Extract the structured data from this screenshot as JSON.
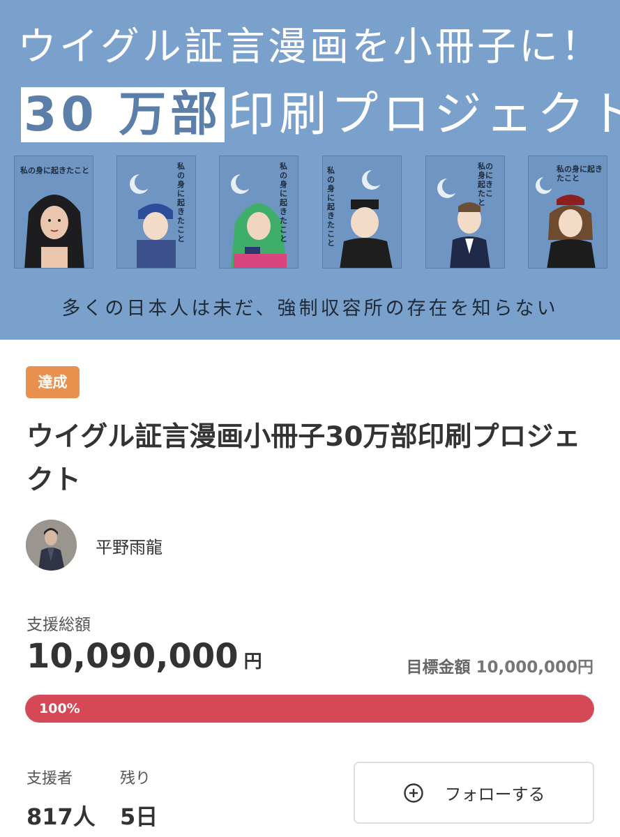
{
  "hero": {
    "line1": "ウイグル証言漫画を小冊子に！",
    "line2_highlight": "30 万部",
    "line2_rest": "印刷プロジェクト",
    "covers": [
      {
        "title": "私の身に起きたこと"
      },
      {
        "title": "私の身に起きたこと"
      },
      {
        "title": "私の身に起きたこと"
      },
      {
        "title": "私の身に起きたこと"
      },
      {
        "title": "私の身に起きたこと"
      },
      {
        "title": "私の身に起きたこと"
      }
    ],
    "caption": "多くの日本人は未だ、強制収容所の存在を知らない"
  },
  "project": {
    "status_badge": "達成",
    "title": "ウイグル証言漫画小冊子30万部印刷プロジェクト",
    "owner_name": "平野雨龍"
  },
  "funding": {
    "support_label": "支援総額",
    "support_amount": "10,090,000",
    "currency": "円",
    "goal_label": "目標金額",
    "goal_amount": "10,000,000円",
    "progress_percent": 100,
    "progress_text": "100%"
  },
  "stats": {
    "backers_label": "支援者",
    "backers_value": "817人",
    "remaining_label": "残り",
    "remaining_value": "5日"
  },
  "actions": {
    "follow_label": "フォローする"
  },
  "colors": {
    "hero_bg": "#7aa0cc",
    "badge": "#e8904e",
    "progress": "#d54856"
  }
}
